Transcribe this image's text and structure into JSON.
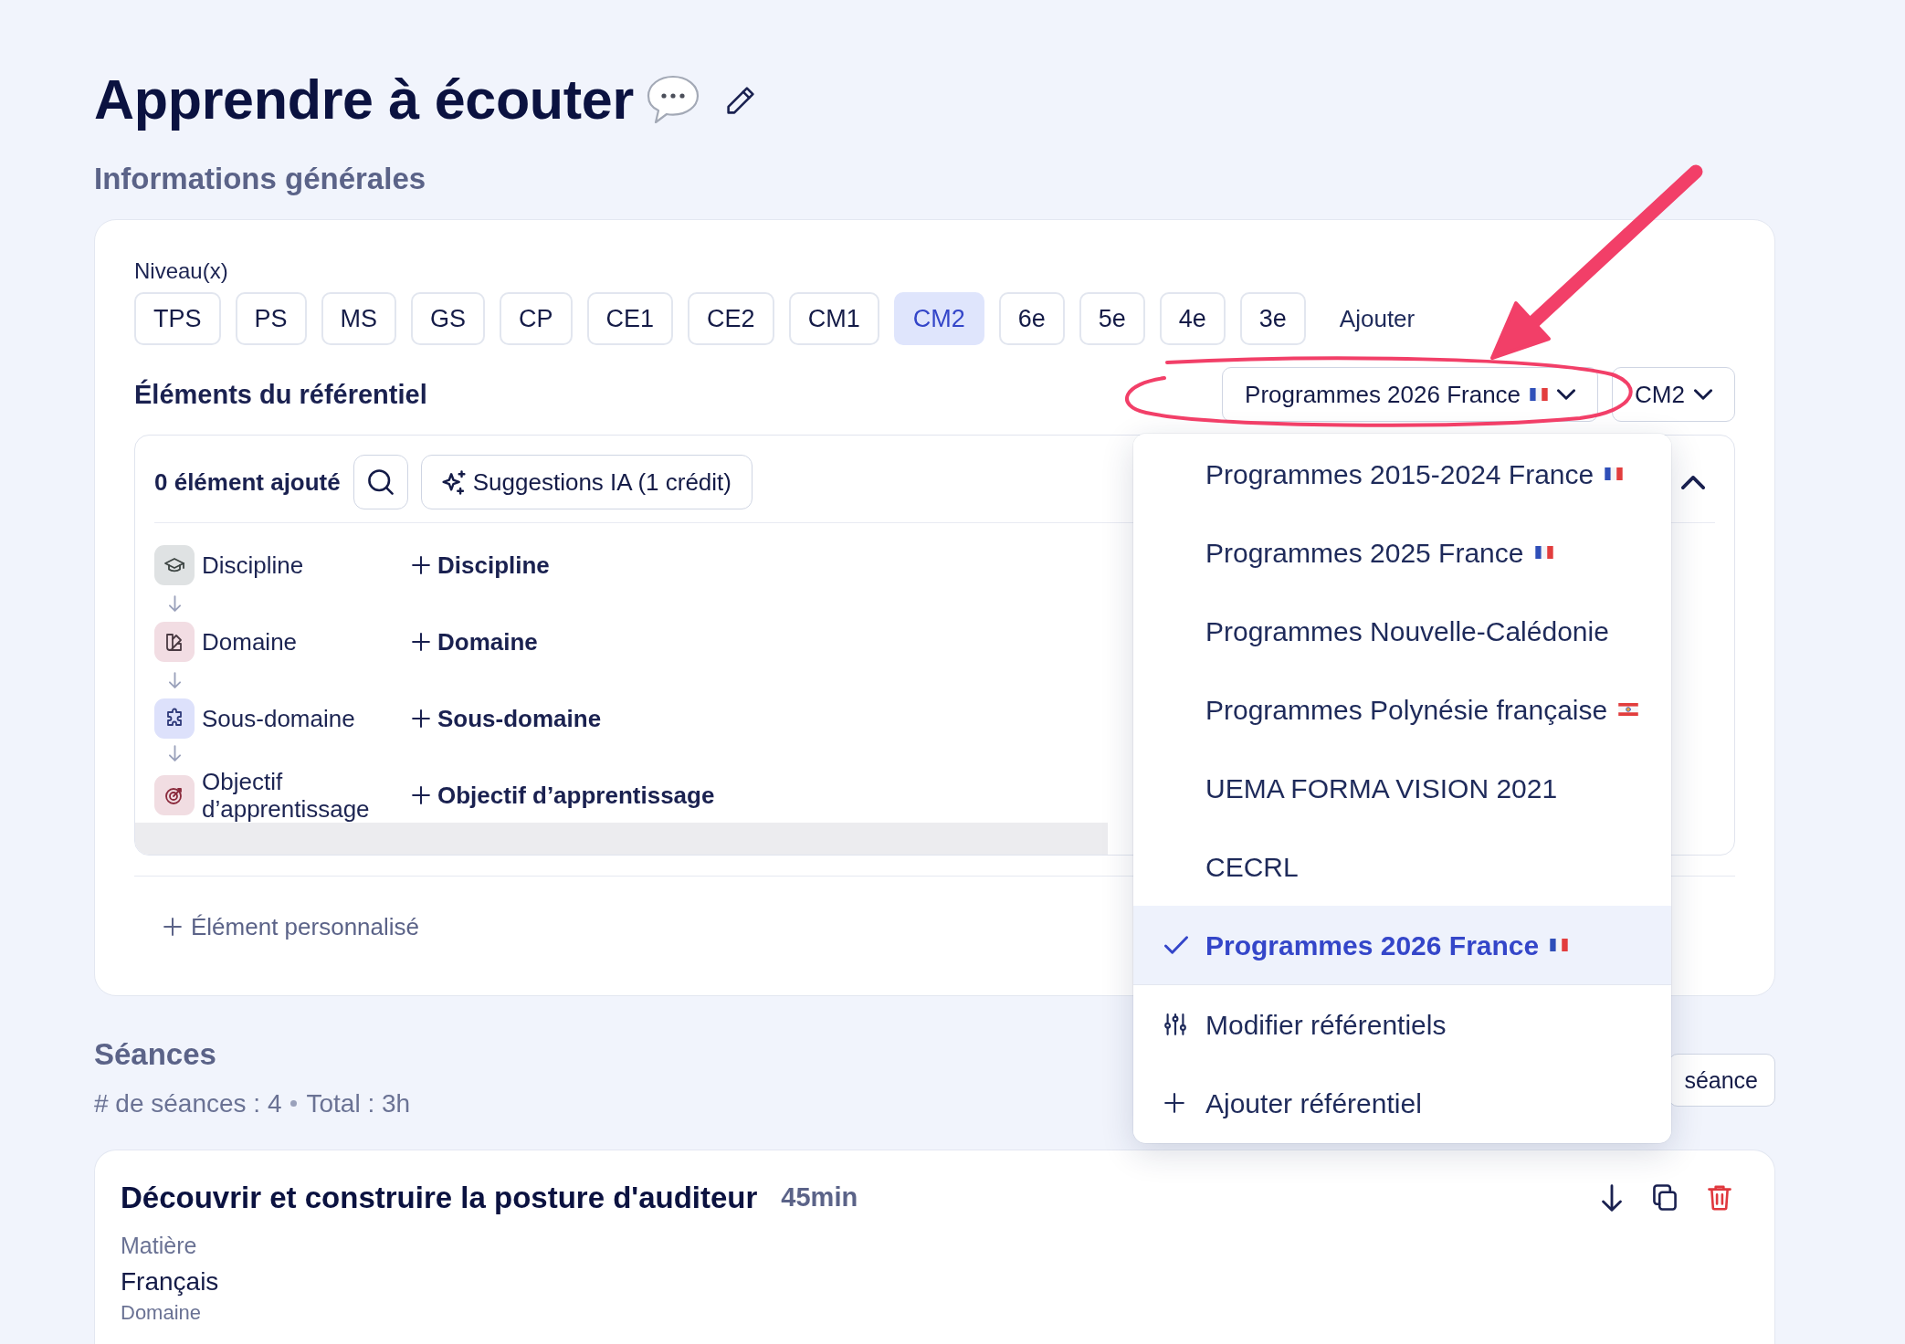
{
  "page": {
    "title": "Apprendre à écouter"
  },
  "general": {
    "heading": "Informations générales",
    "levels_label": "Niveau(x)",
    "levels": [
      {
        "label": "TPS",
        "selected": false
      },
      {
        "label": "PS",
        "selected": false
      },
      {
        "label": "MS",
        "selected": false
      },
      {
        "label": "GS",
        "selected": false
      },
      {
        "label": "CP",
        "selected": false
      },
      {
        "label": "CE1",
        "selected": false
      },
      {
        "label": "CE2",
        "selected": false
      },
      {
        "label": "CM1",
        "selected": false
      },
      {
        "label": "CM2",
        "selected": true
      },
      {
        "label": "6e",
        "selected": false
      },
      {
        "label": "5e",
        "selected": false
      },
      {
        "label": "4e",
        "selected": false
      },
      {
        "label": "3e",
        "selected": false
      }
    ],
    "add_level": "Ajouter",
    "elements_heading": "Éléments du référentiel",
    "referential_select": {
      "value": "Programmes 2026 France",
      "kind": "france"
    },
    "level_select": {
      "value": "CM2"
    },
    "panel": {
      "count": "0 élément ajouté",
      "suggestions_button": "Suggestions IA (1 crédit)",
      "expanded": true,
      "hierarchy": [
        {
          "kind": "discipline",
          "label": "Discipline",
          "add": "Discipline"
        },
        {
          "kind": "domain",
          "label": "Domaine",
          "add": "Domaine"
        },
        {
          "kind": "subdomain",
          "label": "Sous-domaine",
          "add": "Sous-domaine"
        },
        {
          "kind": "objective",
          "label": "Objectif d’apprentissage",
          "add": "Objectif d’apprentissage"
        }
      ]
    },
    "custom_element": "Élément personnalisé"
  },
  "referential_menu": {
    "options": [
      {
        "label": "Programmes 2015-2024 France",
        "kind": "france",
        "selected": false
      },
      {
        "label": "Programmes 2025 France",
        "kind": "france",
        "selected": false
      },
      {
        "label": "Programmes Nouvelle-Calédonie",
        "kind": "plain",
        "selected": false
      },
      {
        "label": "Programmes Polynésie française",
        "kind": "polynesia",
        "selected": false
      },
      {
        "label": "UEMA FORMA VISION 2021",
        "kind": "plain",
        "selected": false
      },
      {
        "label": "CECRL",
        "kind": "plain",
        "selected": false
      },
      {
        "label": "Programmes 2026 France",
        "kind": "france",
        "selected": true
      }
    ],
    "actions": [
      {
        "kind": "edit",
        "label": "Modifier référentiels"
      },
      {
        "kind": "add",
        "label": "Ajouter référentiel"
      }
    ]
  },
  "sessions": {
    "heading": "Séances",
    "stats": [
      "# de séances : 4",
      "Total : 3h"
    ],
    "add_button": "séance",
    "items": [
      {
        "title": "Découvrir et construire la posture d'auditeur",
        "duration": "45min",
        "fields": [
          {
            "label": "Matière",
            "value": "Français"
          },
          {
            "label": "Domaine"
          }
        ]
      }
    ]
  }
}
